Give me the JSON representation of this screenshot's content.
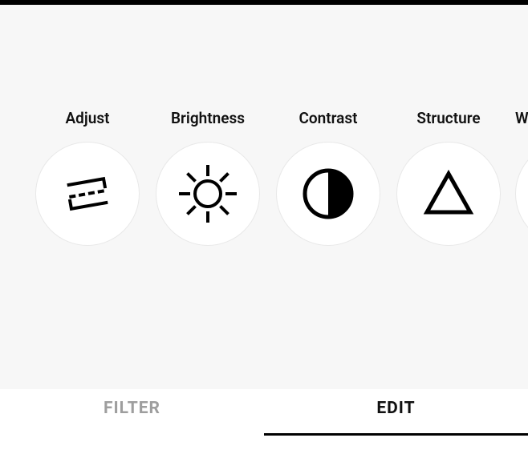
{
  "tools": [
    {
      "label": "Adjust",
      "icon": "adjust-icon"
    },
    {
      "label": "Brightness",
      "icon": "brightness-icon"
    },
    {
      "label": "Contrast",
      "icon": "contrast-icon"
    },
    {
      "label": "Structure",
      "icon": "structure-icon"
    },
    {
      "label": "W",
      "icon": "warmth-icon"
    }
  ],
  "tabs": {
    "filter": "FILTER",
    "edit": "EDIT",
    "active": "edit"
  }
}
